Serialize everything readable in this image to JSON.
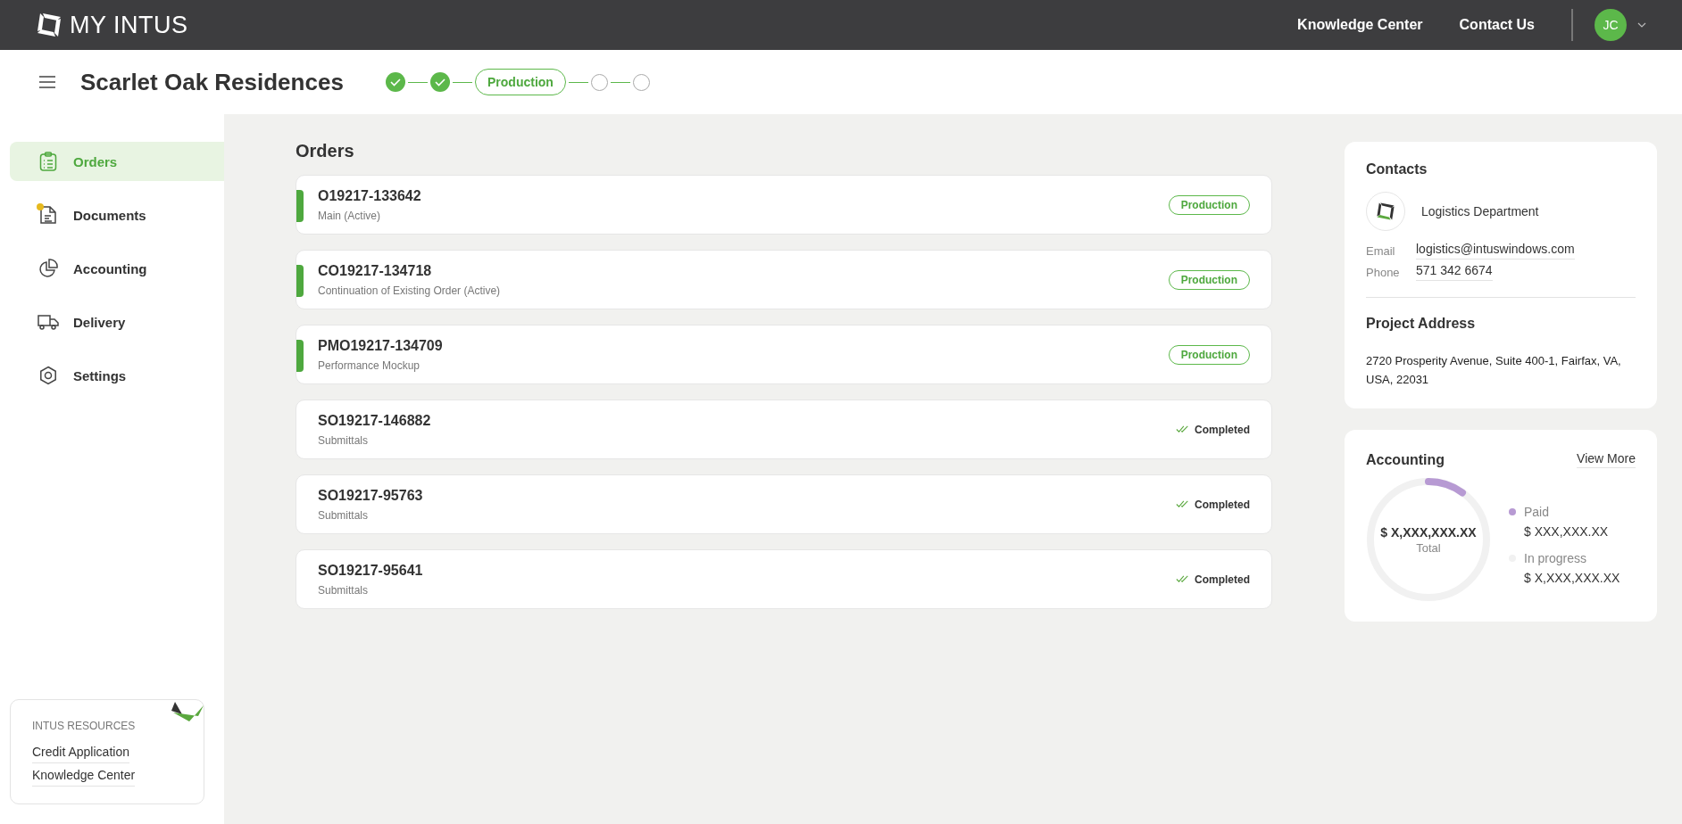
{
  "topbar": {
    "brand": "MY INTUS",
    "links": [
      "Knowledge Center",
      "Contact Us"
    ],
    "avatar": "JC"
  },
  "project": {
    "title": "Scarlet Oak Residences",
    "steps": [
      {
        "kind": "done"
      },
      {
        "kind": "done"
      },
      {
        "kind": "current",
        "label": "Production"
      },
      {
        "kind": "pending"
      },
      {
        "kind": "pending"
      }
    ]
  },
  "sidebar": {
    "items": [
      {
        "label": "Orders",
        "selected": true,
        "notification": false
      },
      {
        "label": "Documents",
        "selected": false,
        "notification": true
      },
      {
        "label": "Accounting",
        "selected": false,
        "notification": false
      },
      {
        "label": "Delivery",
        "selected": false,
        "notification": false
      },
      {
        "label": "Settings",
        "selected": false,
        "notification": false
      }
    ],
    "resources": {
      "title": "INTUS RESOURCES",
      "links": [
        "Credit Application",
        "Knowledge Center"
      ]
    }
  },
  "orders": {
    "title": "Orders",
    "items": [
      {
        "number": "O19217-133642",
        "type": "Main (Active)",
        "active": true,
        "status": {
          "kind": "badge",
          "label": "Production"
        }
      },
      {
        "number": "CO19217-134718",
        "type": "Continuation of Existing Order (Active)",
        "active": true,
        "status": {
          "kind": "badge",
          "label": "Production"
        }
      },
      {
        "number": "PMO19217-134709",
        "type": "Performance Mockup",
        "active": true,
        "status": {
          "kind": "badge",
          "label": "Production"
        }
      },
      {
        "number": "SO19217-146882",
        "type": "Submittals",
        "active": false,
        "status": {
          "kind": "completed",
          "label": "Completed"
        }
      },
      {
        "number": "SO19217-95763",
        "type": "Submittals",
        "active": false,
        "status": {
          "kind": "completed",
          "label": "Completed"
        }
      },
      {
        "number": "SO19217-95641",
        "type": "Submittals",
        "active": false,
        "status": {
          "kind": "completed",
          "label": "Completed"
        }
      }
    ]
  },
  "contacts": {
    "title": "Contacts",
    "name": "Logistics Department",
    "fields": [
      {
        "label": "Email",
        "value": "logistics@intuswindows.com"
      },
      {
        "label": "Phone",
        "value": "571 342 6674"
      }
    ]
  },
  "project_address": {
    "title": "Project Address",
    "address": "2720 Prosperity Avenue, Suite 400-1, Fairfax, VA, USA, 22031"
  },
  "accounting": {
    "title": "Accounting",
    "link": "View More",
    "total": "$ X,XXX,XXX.XX",
    "total_label": "Total",
    "legend": [
      {
        "label": "Paid",
        "value": "$ XXX,XXX.XX",
        "color": "#b79ad3"
      },
      {
        "label": "In progress",
        "value": "$ X,XXX,XXX.XX",
        "color": "#f1f1f1"
      }
    ]
  }
}
